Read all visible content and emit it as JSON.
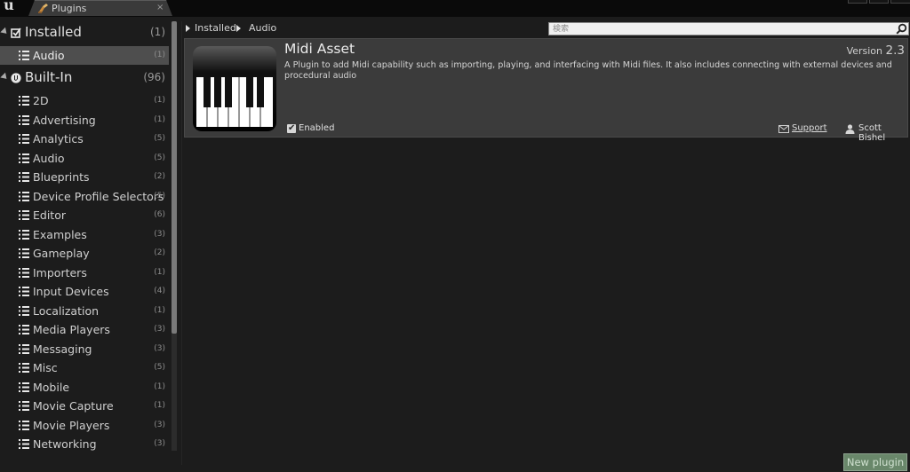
{
  "tab": {
    "title": "Plugins",
    "close_glyph": "×",
    "icon": "plugin-icon"
  },
  "app": {
    "logo_glyph": "u"
  },
  "sidebar": {
    "categories": [
      {
        "label": "Installed",
        "count": "(1)",
        "icon": "installed-icon",
        "items": [
          {
            "label": "Audio",
            "count": "(1)",
            "selected": true
          }
        ]
      },
      {
        "label": "Built-In",
        "count": "(96)",
        "icon": "unreal-engine-icon",
        "items": [
          {
            "label": "2D",
            "count": "(1)"
          },
          {
            "label": "Advertising",
            "count": "(1)"
          },
          {
            "label": "Analytics",
            "count": "(5)"
          },
          {
            "label": "Audio",
            "count": "(5)"
          },
          {
            "label": "Blueprints",
            "count": "(2)"
          },
          {
            "label": "Device Profile Selectors",
            "count": "(5)"
          },
          {
            "label": "Editor",
            "count": "(6)"
          },
          {
            "label": "Examples",
            "count": "(3)"
          },
          {
            "label": "Gameplay",
            "count": "(2)"
          },
          {
            "label": "Importers",
            "count": "(1)"
          },
          {
            "label": "Input Devices",
            "count": "(4)"
          },
          {
            "label": "Localization",
            "count": "(1)"
          },
          {
            "label": "Media Players",
            "count": "(3)"
          },
          {
            "label": "Messaging",
            "count": "(3)"
          },
          {
            "label": "Misc",
            "count": "(5)"
          },
          {
            "label": "Mobile",
            "count": "(1)"
          },
          {
            "label": "Movie Capture",
            "count": "(1)"
          },
          {
            "label": "Movie Players",
            "count": "(3)"
          },
          {
            "label": "Networking",
            "count": "(3)"
          }
        ]
      }
    ]
  },
  "breadcrumb": [
    "Installed",
    "Audio"
  ],
  "search": {
    "placeholder": "検索",
    "value": ""
  },
  "plugin": {
    "name": "Midi Asset",
    "version_label": "Version",
    "version": "2.3",
    "description": "A Plugin to add Midi capability such as importing, playing, and interfacing with Midi files.  It also includes connecting with external devices and procedural audio",
    "enabled_label": "Enabled",
    "enabled": true,
    "support_label": "Support",
    "author": "Scott Bishel",
    "icon": "piano-keys-icon"
  },
  "footer": {
    "new_plugin_label": "New plugin"
  },
  "colors": {
    "background": "#1c1c1c",
    "card": "#3b3b3b",
    "selected": "#4e4e4e",
    "new_plugin_button": "#69876a"
  }
}
